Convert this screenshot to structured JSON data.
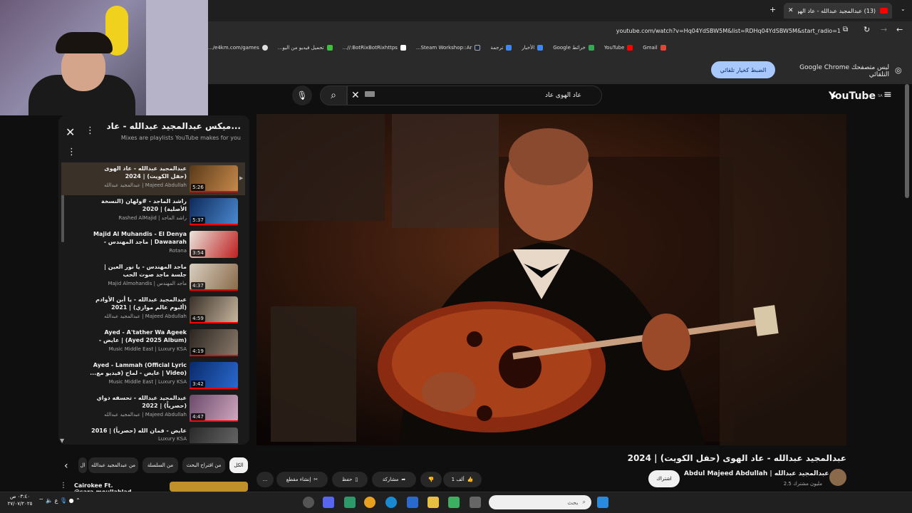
{
  "browser": {
    "tab_title": "(13) عبدالمجيد عبدالله - عاد الهوى...",
    "url": "youtube.com/watch?v=Hq04YdSBW5M&list=RDHq04YdSBW5M&start_radio=1",
    "bookmarks": [
      "Gmail",
      "YouTube",
      "خرائط Google",
      "الأخبار",
      "ترجمة",
      "Steam Workshop::Ar...",
      "BotRixBotRixhttps://...",
      "تحميل فيديو من اليو...",
      "e4km.com/games/..."
    ],
    "info_text": "Google Chrome ليس متصفحك التلقائي",
    "info_button": "الضبط كخيار تلقائي"
  },
  "youtube": {
    "logo_text": "YouTube",
    "logo_region": "SA",
    "search_value": "عاد الهوى عاد"
  },
  "playlist": {
    "title": "ميكس عبدالمجيد عبدالله - عاد...",
    "subtitle": "Mixes are playlists YouTube makes for you",
    "items": [
      {
        "title": "عبدالمجيد عبدالله - عاد الهوى (حفل الكويت) | 2024",
        "channel": "عبدالمجيد عبدالله | Majeed Abdullah",
        "duration": "5:26"
      },
      {
        "title": "راشد الماجد - #ولهان (النسخة الأصلية) | 2020",
        "channel": "Rashed AlMajid | راشد الماجد",
        "duration": "5:37"
      },
      {
        "title": "Majid Al Muhandis - El Denya Dawaarah | ماجد المهندس - الدنيا دوارة",
        "channel": "Rotana",
        "duration": "3:54"
      },
      {
        "title": "ماجد المهندس - يا نور العين | جلسة ماجد صوت الحب",
        "channel": "Majid Almohandis | ماجد المهندس",
        "duration": "4:37"
      },
      {
        "title": "عبدالمجيد عبدالله - يا أبن الأوادم (ألبوم عالم موازي) | 2021",
        "channel": "عبدالمجيد عبدالله | Majeed Abdullah",
        "duration": "4:59"
      },
      {
        "title": "Ayed - A'tather Wa Ageek (Ayed 2025 Album) | عايض - اعتذر واجيك",
        "channel": "Music Middle East | Luxury KSA",
        "duration": "4:19"
      },
      {
        "title": "Ayed - Lammah (Official Lyric Video) | عايض - لماح (فيديو مع...",
        "channel": "Music Middle East | Luxury KSA",
        "duration": "3:42"
      },
      {
        "title": "عبدالمجيد عبدالله - تحسفه دواي (حصرياً) | 2022",
        "channel": "عبدالمجيد عبدالله | Majeed Abdullah",
        "duration": "4:47"
      },
      {
        "title": "عايض - فمان الله (حصرياً) | 2016",
        "channel": "Luxury KSA",
        "duration": ""
      }
    ]
  },
  "video": {
    "title": "عبدالمجيد عبدالله - عاد الهوى (حفل الكويت) | 2024",
    "channel": "Abdul Majeed Abdullah | عبدالمجيد عبدالله",
    "subscribers": "2.5 مليون مشترك",
    "subscribe_label": "اشتراك",
    "likes": "1 ألف",
    "share_label": "مشاركة",
    "save_label": "حفظ",
    "clip_label": "إنشاء مقطع",
    "more_label": "..."
  },
  "chips": {
    "items": [
      "الكل",
      "من اقتراح البحث",
      "من السلسلة",
      "من عبدالمجيد عبدالله",
      "ال"
    ]
  },
  "next_up": {
    "title": "Cairokee Ft. @sara.moullablad"
  },
  "taskbar": {
    "search_placeholder": "بحث",
    "time": "٠٣:٤٠ ص",
    "date": "٢٧/٠٧/٢٠٢٥",
    "lang": "ع"
  },
  "colors": {
    "accent": "#ff0000",
    "background": "#0f0f0f",
    "panel": "#1a1a1a",
    "info_button": "#a8c7fa"
  }
}
